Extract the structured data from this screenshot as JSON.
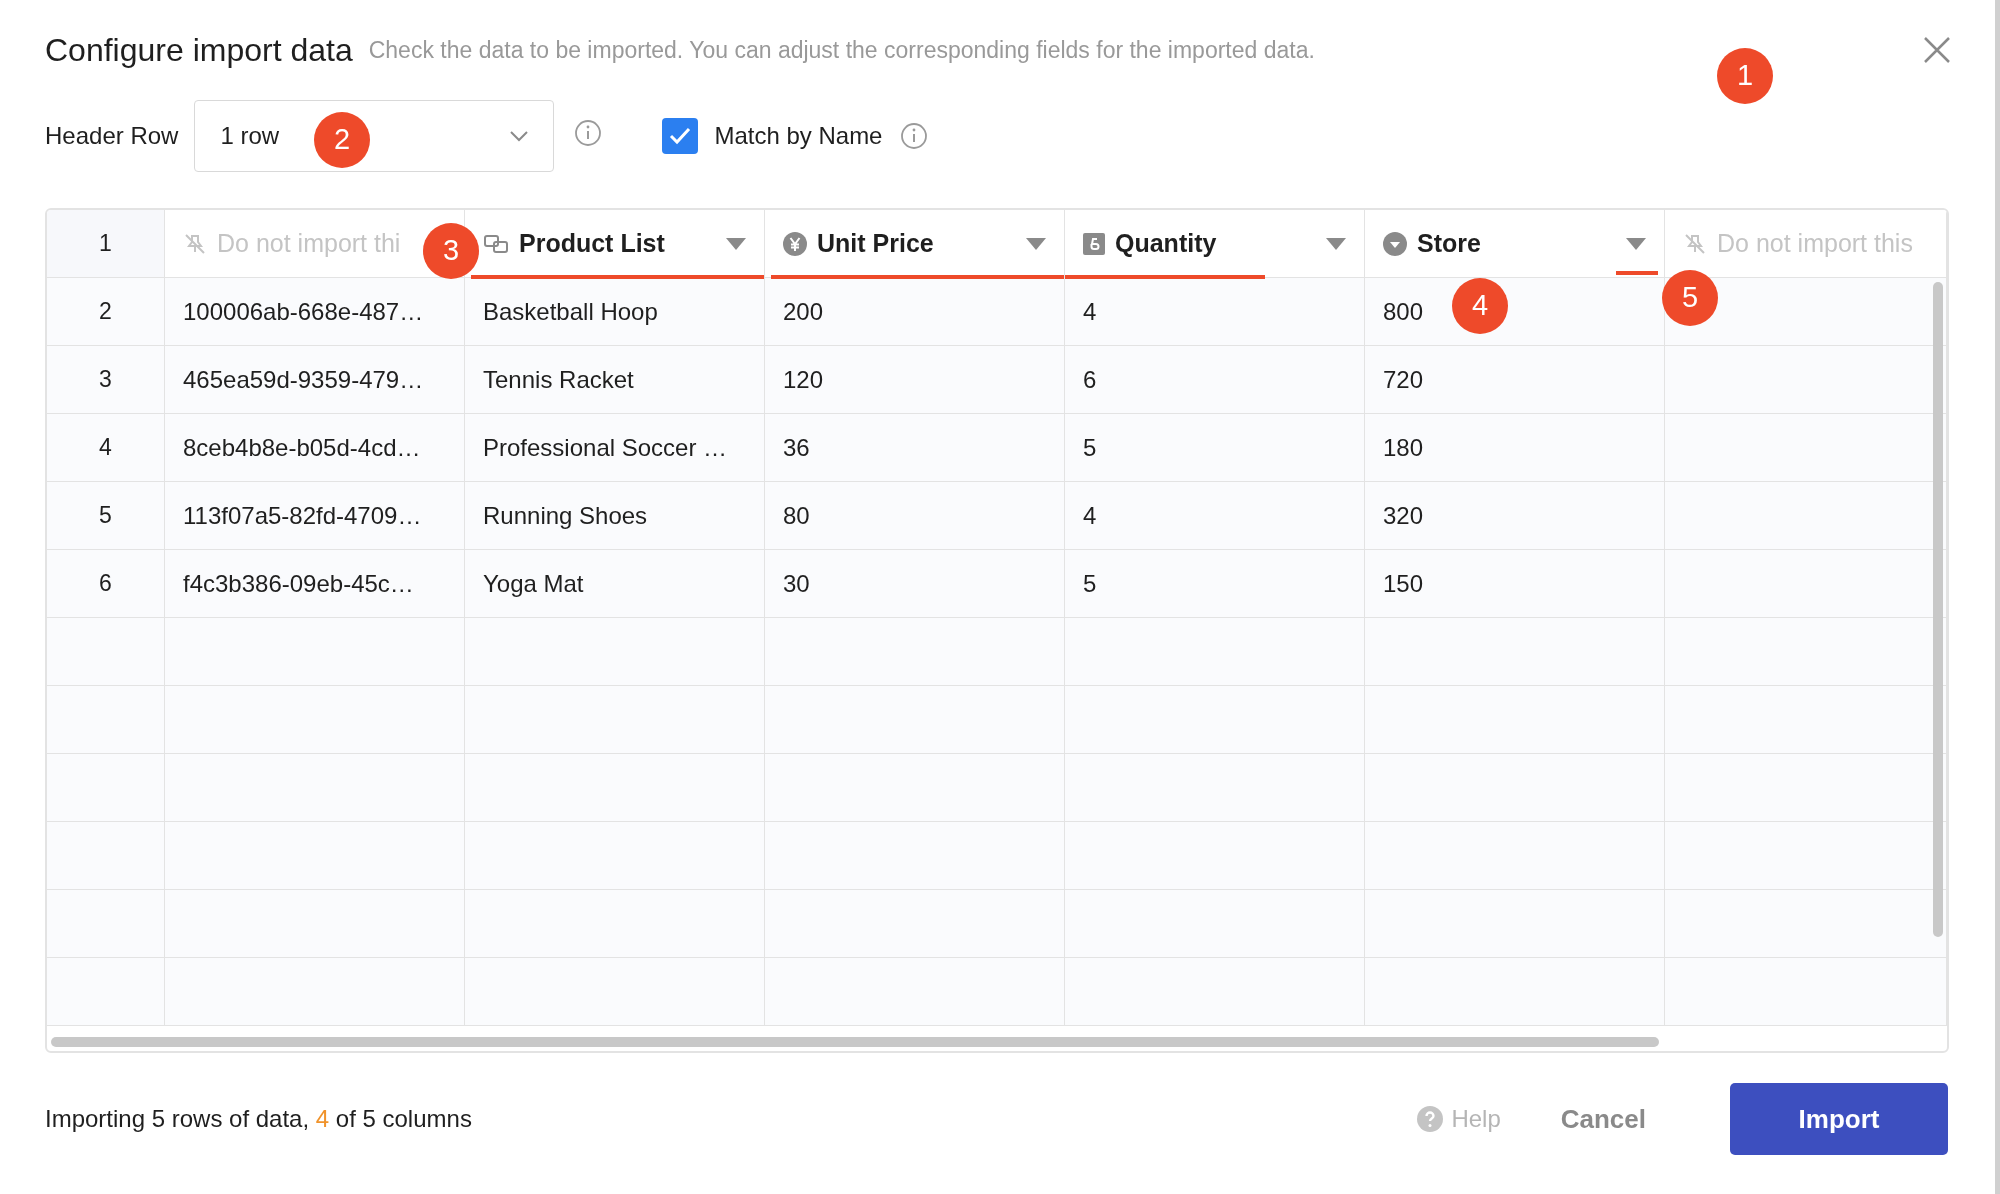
{
  "dialog": {
    "title": "Configure import data",
    "subtitle": "Check the data to be imported. You can adjust the corresponding fields for the imported data."
  },
  "header_row": {
    "label": "Header Row",
    "value": "1 row"
  },
  "match_by_name": {
    "label": "Match by Name",
    "checked": true
  },
  "table": {
    "header_number": "1",
    "columns": [
      {
        "label": "Do not import thi",
        "kind": "ignored"
      },
      {
        "label": "Product List",
        "kind": "link",
        "underline": {
          "kind": "full"
        }
      },
      {
        "label": "Unit Price",
        "kind": "currency",
        "underline": {
          "kind": "full"
        }
      },
      {
        "label": "Quantity",
        "kind": "number",
        "underline": {
          "kind": "partial"
        }
      },
      {
        "label": "Store",
        "kind": "select",
        "underline": {
          "kind": "caret"
        }
      },
      {
        "label": "Do not import this",
        "kind": "ignored"
      }
    ],
    "rows": [
      {
        "number": "2",
        "cells": [
          "100006ab-668e-487…",
          "Basketball Hoop",
          "200",
          "4",
          "800"
        ]
      },
      {
        "number": "3",
        "cells": [
          "465ea59d-9359-479…",
          "Tennis Racket",
          "120",
          "6",
          "720"
        ]
      },
      {
        "number": "4",
        "cells": [
          "8ceb4b8e-b05d-4cd…",
          "Professional Soccer …",
          "36",
          "5",
          "180"
        ]
      },
      {
        "number": "5",
        "cells": [
          "113f07a5-82fd-4709…",
          "Running Shoes",
          "80",
          "4",
          "320"
        ]
      },
      {
        "number": "6",
        "cells": [
          "f4c3b386-09eb-45c…",
          "Yoga Mat",
          "30",
          "5",
          "150"
        ]
      }
    ]
  },
  "footer": {
    "summary_before": "Importing 5 rows of data, ",
    "summary_count": "4",
    "summary_after": " of 5 columns",
    "help": "Help",
    "cancel": "Cancel",
    "import": "Import"
  },
  "annotations": [
    {
      "label": "1"
    },
    {
      "label": "2"
    },
    {
      "label": "3"
    },
    {
      "label": "4"
    },
    {
      "label": "5"
    }
  ]
}
